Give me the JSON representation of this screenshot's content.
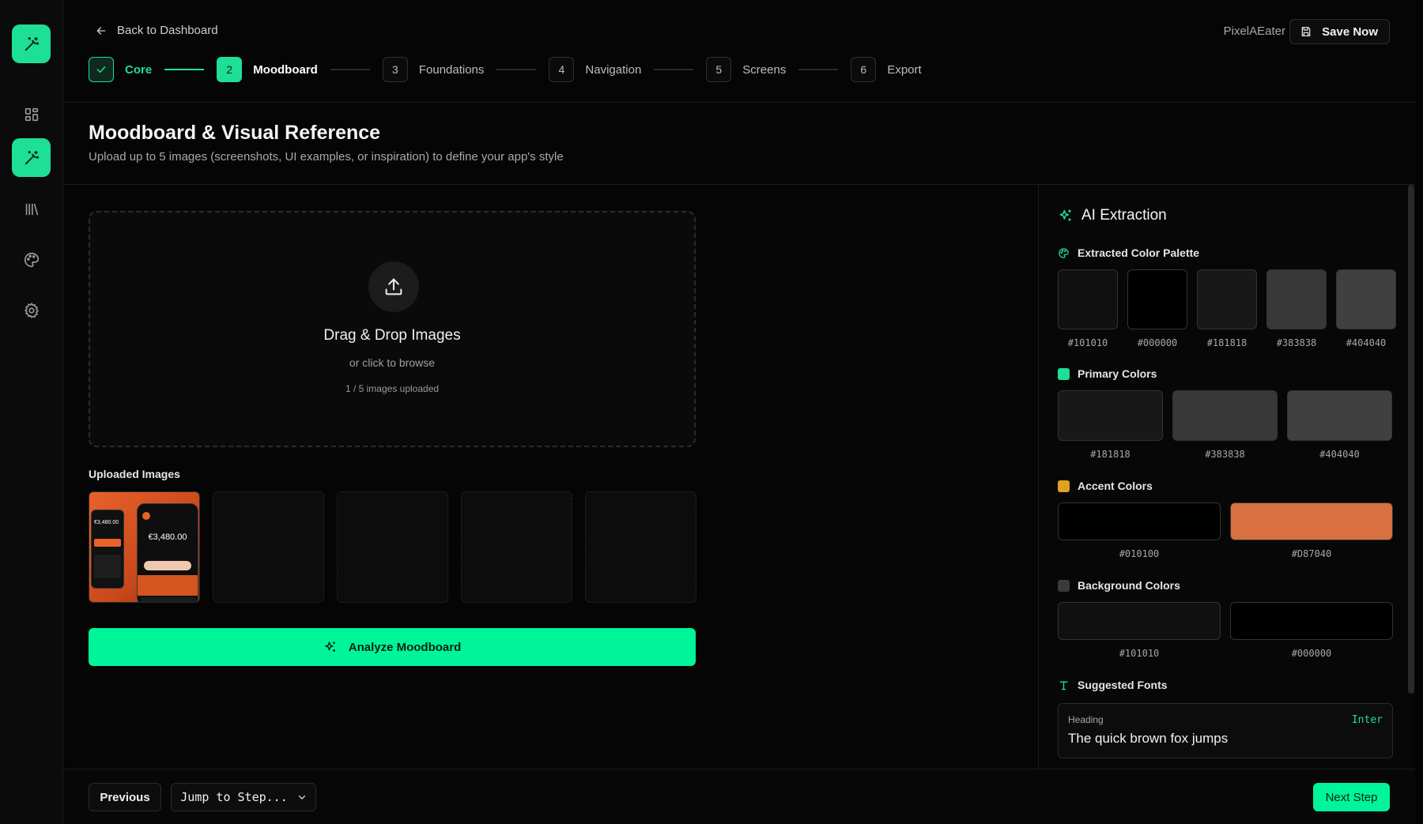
{
  "sidebar": {
    "logo_icon": "magic-wand-icon",
    "items": [
      {
        "icon": "grid-icon",
        "active": false
      },
      {
        "icon": "magic-wand-icon",
        "active": true
      },
      {
        "icon": "library-icon",
        "active": false
      },
      {
        "icon": "palette-icon",
        "active": false
      },
      {
        "icon": "gear-icon",
        "active": false
      }
    ]
  },
  "header": {
    "back_label": "Back to Dashboard",
    "username": "PixelAEater",
    "save_label": "Save Now"
  },
  "steps": [
    {
      "num": "1",
      "label": "Core",
      "state": "done"
    },
    {
      "num": "2",
      "label": "Moodboard",
      "state": "current"
    },
    {
      "num": "3",
      "label": "Foundations",
      "state": "upcoming"
    },
    {
      "num": "4",
      "label": "Navigation",
      "state": "upcoming"
    },
    {
      "num": "5",
      "label": "Screens",
      "state": "upcoming"
    },
    {
      "num": "6",
      "label": "Export",
      "state": "upcoming"
    }
  ],
  "page": {
    "title": "Moodboard & Visual Reference",
    "subtitle": "Upload up to 5 images (screenshots, UI examples, or inspiration) to define your app's style"
  },
  "dropzone": {
    "title": "Drag & Drop Images",
    "subtitle": "or click to browse",
    "count": "1 / 5 images uploaded"
  },
  "uploaded": {
    "title": "Uploaded Images",
    "thumb_balance_left": "€3,480.00",
    "thumb_balance_right": "€3,480.00"
  },
  "analyze_label": "Analyze Moodboard",
  "panel": {
    "title": "AI Extraction",
    "palette": {
      "title": "Extracted Color Palette",
      "colors": [
        "#101010",
        "#000000",
        "#181818",
        "#383838",
        "#404040"
      ]
    },
    "primary": {
      "title": "Primary Colors",
      "marker": "#1ddf95",
      "colors": [
        "#181818",
        "#383838",
        "#404040"
      ]
    },
    "accent": {
      "title": "Accent Colors",
      "marker": "#e0a020",
      "colors": [
        "#010100",
        "#D87040"
      ]
    },
    "background": {
      "title": "Background Colors",
      "marker": "#3a3a3a",
      "colors": [
        "#101010",
        "#000000"
      ]
    },
    "fonts": {
      "title": "Suggested Fonts",
      "role": "Heading",
      "name": "Inter",
      "sample": "The quick brown fox jumps"
    }
  },
  "footer": {
    "previous_label": "Previous",
    "jump_label": "Jump to Step...",
    "next_label": "Next Step"
  },
  "colors": {
    "accent": "#1ddf95",
    "cta": "#00f59b",
    "background": "#050505"
  }
}
